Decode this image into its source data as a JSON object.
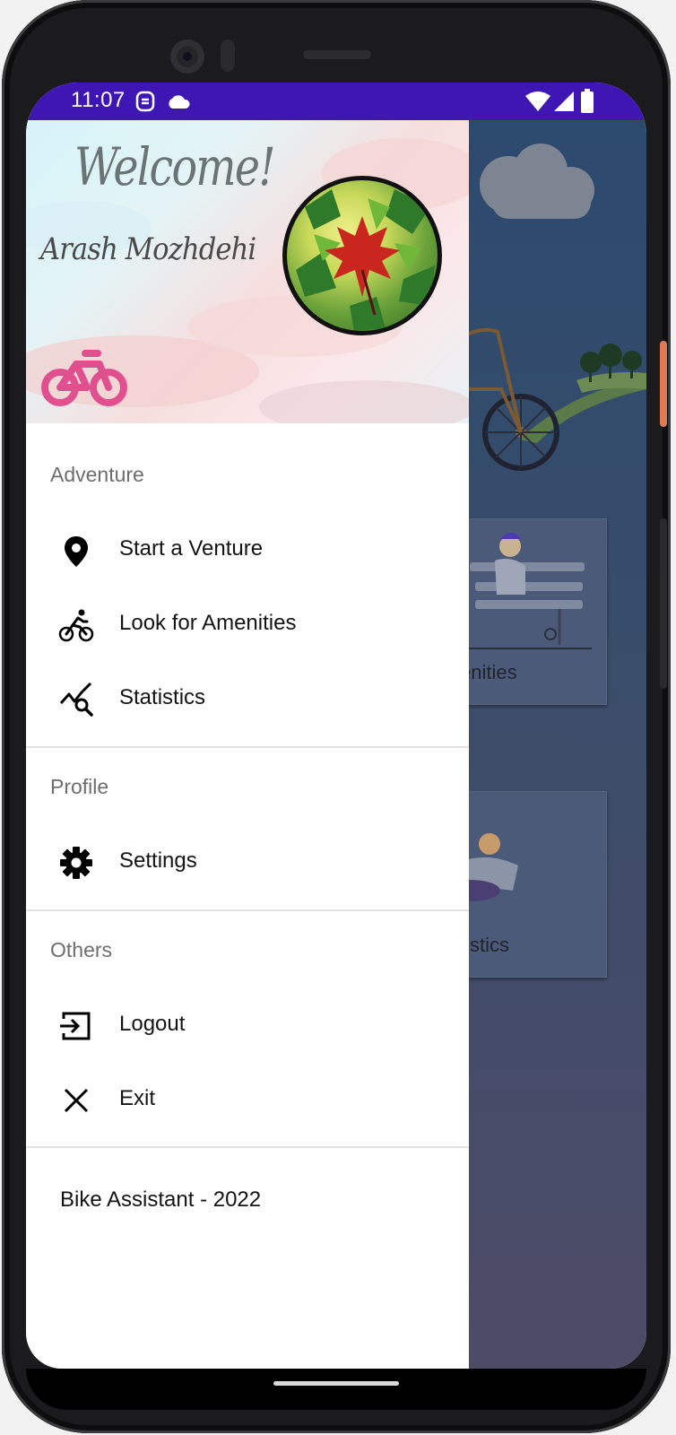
{
  "status_bar": {
    "time": "11:07"
  },
  "drawer": {
    "header": {
      "welcome": "Welcome!",
      "username": "Arash Mozhdehi"
    },
    "sections": {
      "adventure": "Adventure",
      "profile": "Profile",
      "others": "Others"
    },
    "items": {
      "start_venture": "Start a Venture",
      "amenities": "Look for Amenities",
      "statistics": "Statistics",
      "settings": "Settings",
      "logout": "Logout",
      "exit": "Exit"
    },
    "footer": "Bike Assistant - 2022"
  },
  "background": {
    "card_amenities_label": "Amenities",
    "card_statistics_label": "Statistics"
  },
  "colors": {
    "status_bar": "#3d16b3",
    "scrim": "#3a4d6b",
    "bike_logo": "#e0508f"
  }
}
